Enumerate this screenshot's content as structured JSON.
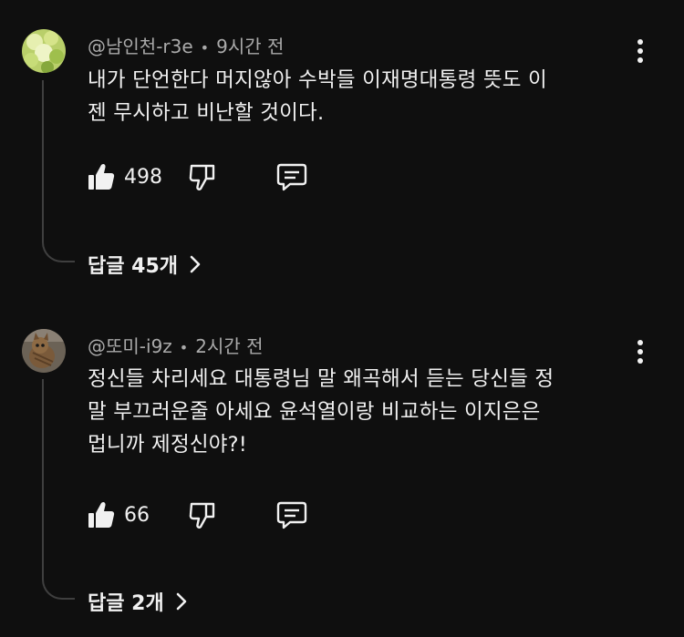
{
  "comments": [
    {
      "author": "@남인천-r3e",
      "separator": "•",
      "time": "9시간 전",
      "lines": [
        "내가 단언한다 머지않아 수박들 이재명대통령 뜻도 이",
        "젠 무시하고 비난할 것이다."
      ],
      "likes": "498",
      "replies_label": "답글 45개"
    },
    {
      "author": "@또미-i9z",
      "separator": "•",
      "time": "2시간 전",
      "lines": [
        "정신들 차리세요 대통령님 말 왜곡해서 듣는 당신들 정",
        "말 부끄러운줄 아세요 윤석열이랑 비교하는 이지은은",
        "멉니까 제정신야?!"
      ],
      "likes": "66",
      "replies_label": "답글 2개"
    }
  ],
  "icons": {
    "like": "thumbs-up-icon",
    "dislike": "thumbs-down-icon",
    "reply": "reply-comment-icon",
    "menu": "more-vertical-icon",
    "expand": "chevron-right-icon"
  },
  "colors": {
    "background": "#0f0f0f",
    "text": "#f1f1f1",
    "meta": "#aaaaaa",
    "thread": "#3f3f3f"
  }
}
